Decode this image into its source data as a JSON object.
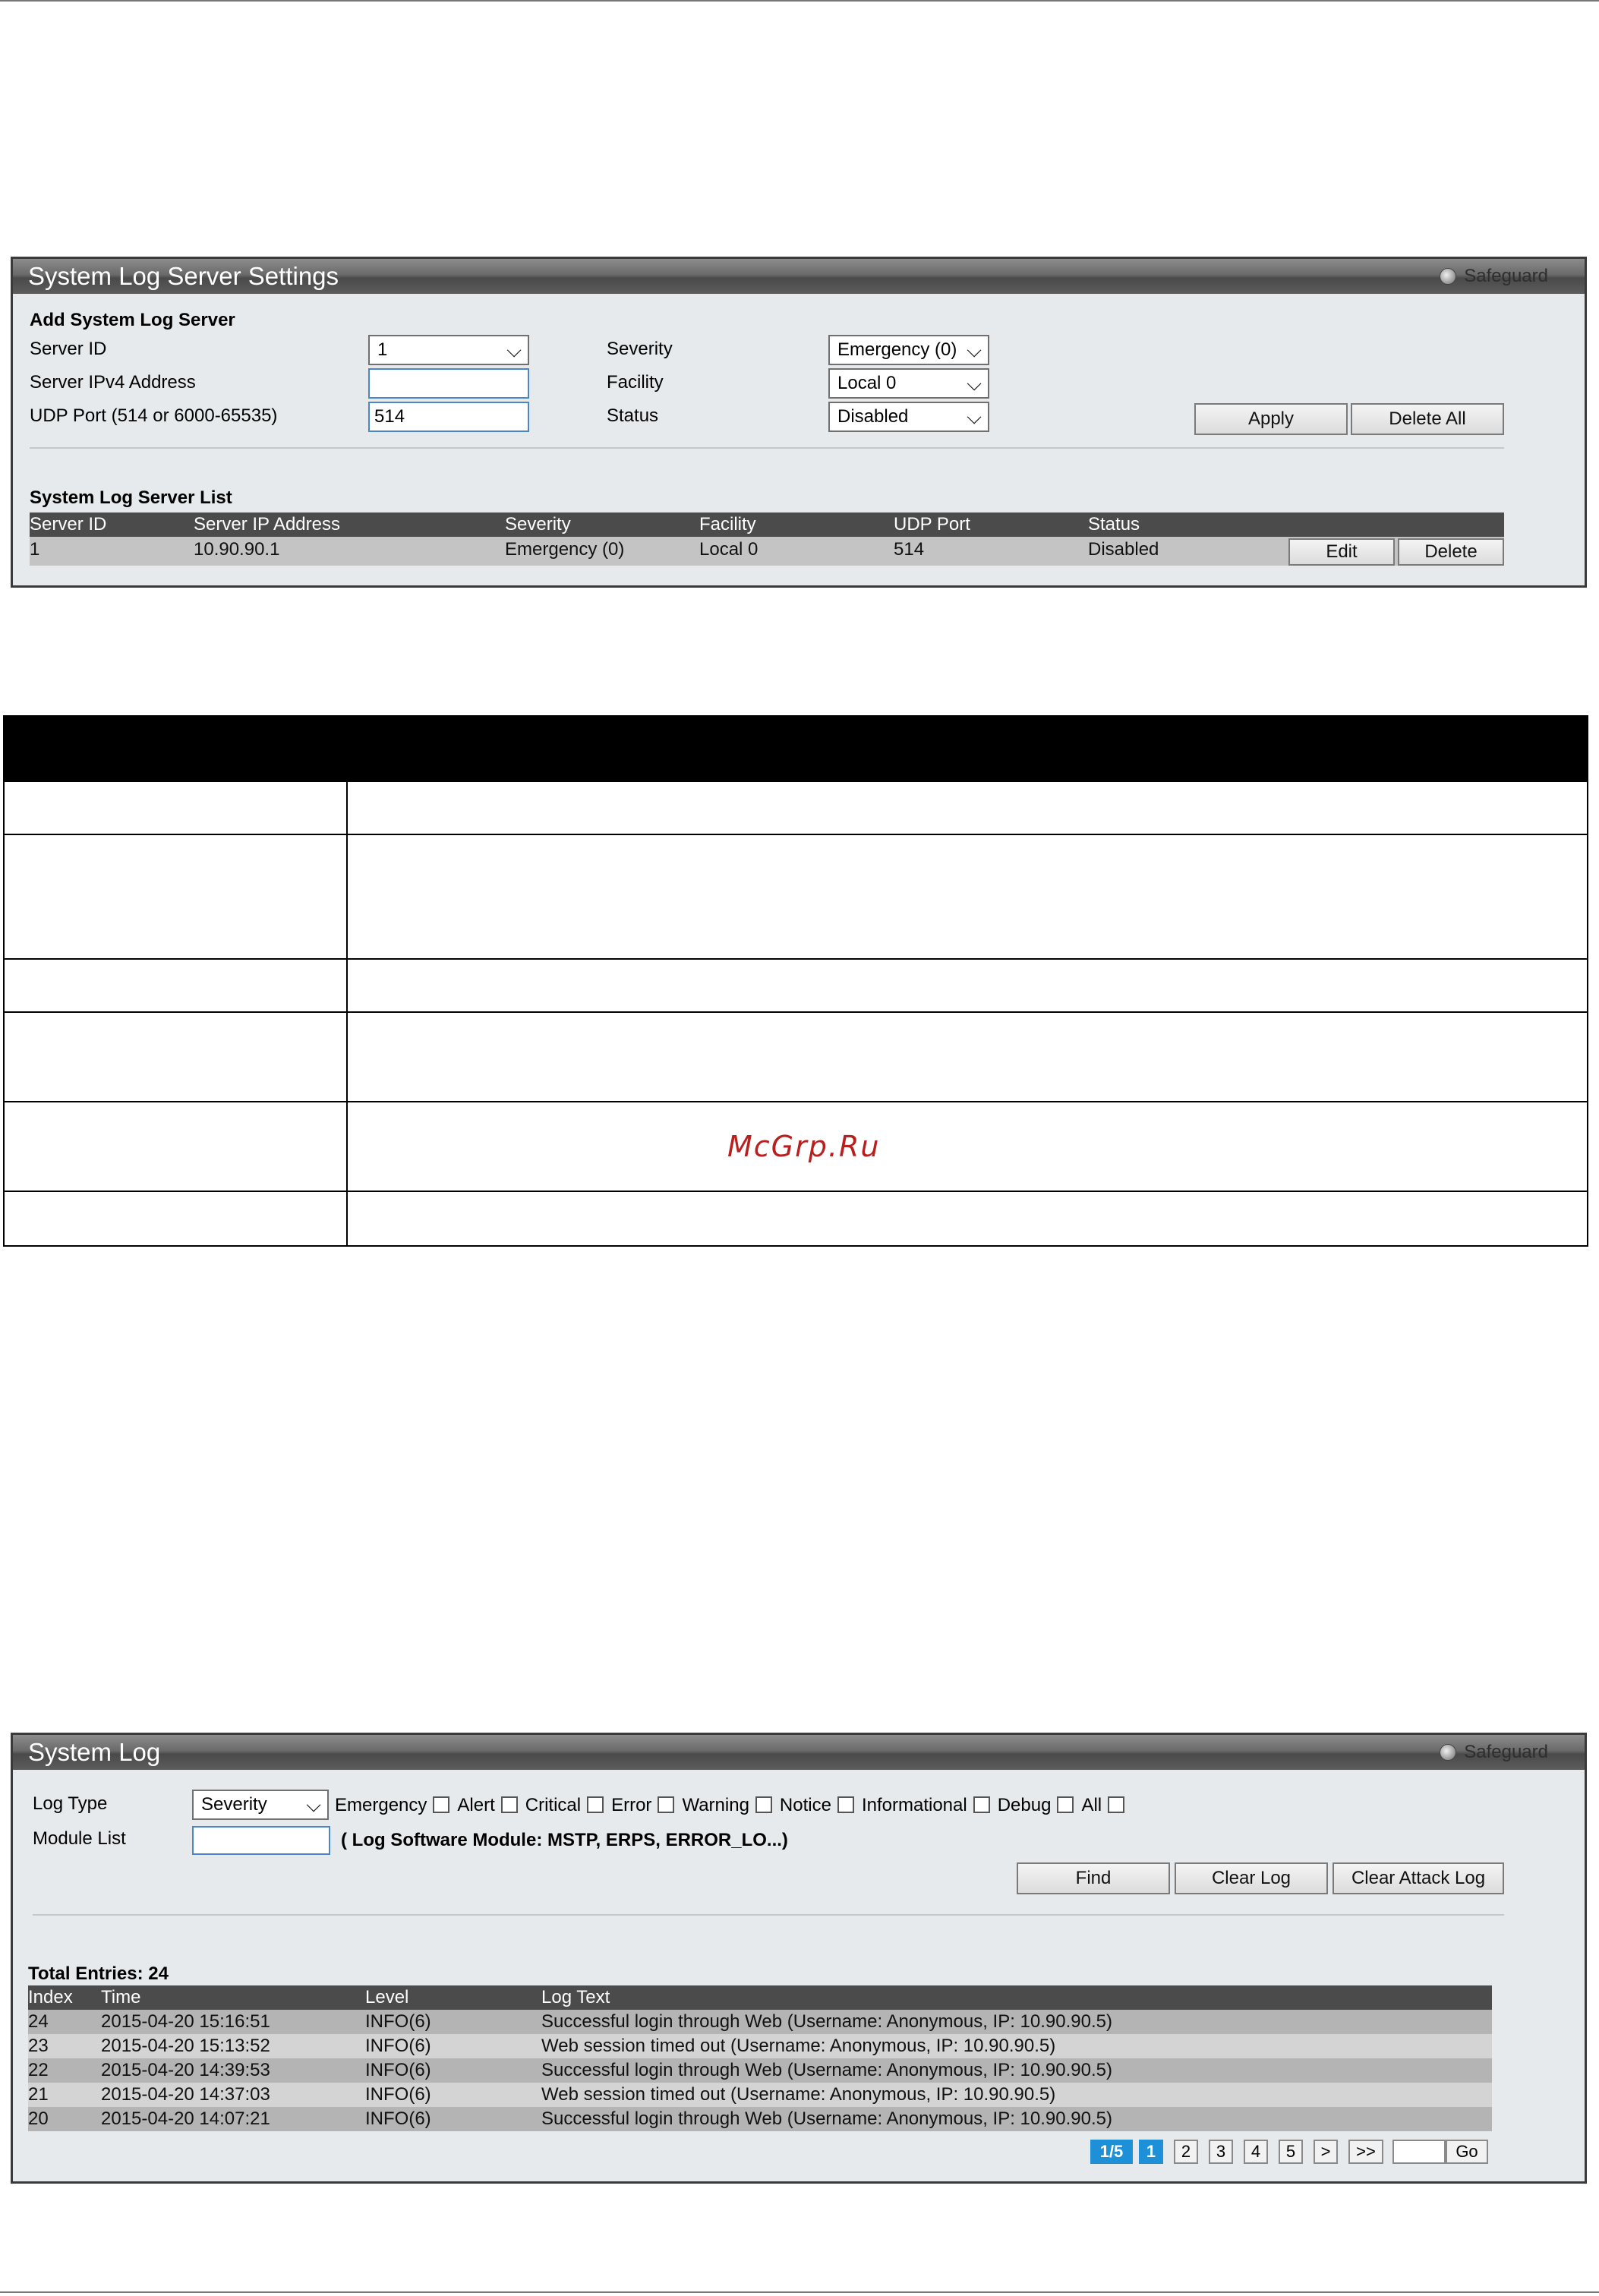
{
  "syslog_server": {
    "title": "System Log Server Settings",
    "safeguard": "Safeguard",
    "add_heading": "Add System Log Server",
    "server_id_label": "Server ID",
    "server_id_value": "1",
    "ipv4_label": "Server IPv4 Address",
    "ipv4_value": "",
    "udp_label": "UDP Port (514 or 6000-65535)",
    "udp_value": "514",
    "severity_label": "Severity",
    "severity_value": "Emergency (0)",
    "facility_label": "Facility",
    "facility_value": "Local 0",
    "status_label": "Status",
    "status_value": "Disabled",
    "apply_label": "Apply",
    "delete_all_label": "Delete All",
    "list_heading": "System Log Server List",
    "columns": [
      "Server ID",
      "Server IP Address",
      "Severity",
      "Facility",
      "UDP Port",
      "Status"
    ],
    "rows": [
      {
        "server_id": "1",
        "ip": "10.90.90.1",
        "severity": "Emergency (0)",
        "facility": "Local 0",
        "udp_port": "514",
        "status": "Disabled"
      }
    ],
    "edit_label": "Edit",
    "delete_label": "Delete"
  },
  "watermark": "McGrp.Ru",
  "system_log": {
    "title": "System Log",
    "safeguard": "Safeguard",
    "log_type_label": "Log Type",
    "log_type_value": "Severity",
    "levels": [
      "Emergency",
      "Alert",
      "Critical",
      "Error",
      "Warning",
      "Notice",
      "Informational",
      "Debug",
      "All"
    ],
    "module_list_label": "Module List",
    "module_hint": "( Log Software Module: MSTP, ERPS, ERROR_LO...)",
    "find_label": "Find",
    "clear_log_label": "Clear Log",
    "clear_attack_log_label": "Clear Attack Log",
    "total_entries": "Total Entries: 24",
    "columns": [
      "Index",
      "Time",
      "Level",
      "Log Text"
    ],
    "rows": [
      {
        "index": "24",
        "time": "2015-04-20 15:16:51",
        "level": "INFO(6)",
        "text": "Successful login through Web (Username: Anonymous, IP: 10.90.90.5)"
      },
      {
        "index": "23",
        "time": "2015-04-20 15:13:52",
        "level": "INFO(6)",
        "text": "Web session timed out (Username: Anonymous, IP: 10.90.90.5)"
      },
      {
        "index": "22",
        "time": "2015-04-20 14:39:53",
        "level": "INFO(6)",
        "text": "Successful login through Web (Username: Anonymous, IP: 10.90.90.5)"
      },
      {
        "index": "21",
        "time": "2015-04-20 14:37:03",
        "level": "INFO(6)",
        "text": "Web session timed out (Username: Anonymous, IP: 10.90.90.5)"
      },
      {
        "index": "20",
        "time": "2015-04-20 14:07:21",
        "level": "INFO(6)",
        "text": "Successful login through Web (Username: Anonymous, IP: 10.90.90.5)"
      }
    ],
    "pagination": {
      "indicator": "1/5",
      "pages": [
        "1",
        "2",
        "3",
        "4",
        "5"
      ],
      "next": ">",
      "last": ">>",
      "go_label": "Go",
      "go_value": ""
    }
  }
}
